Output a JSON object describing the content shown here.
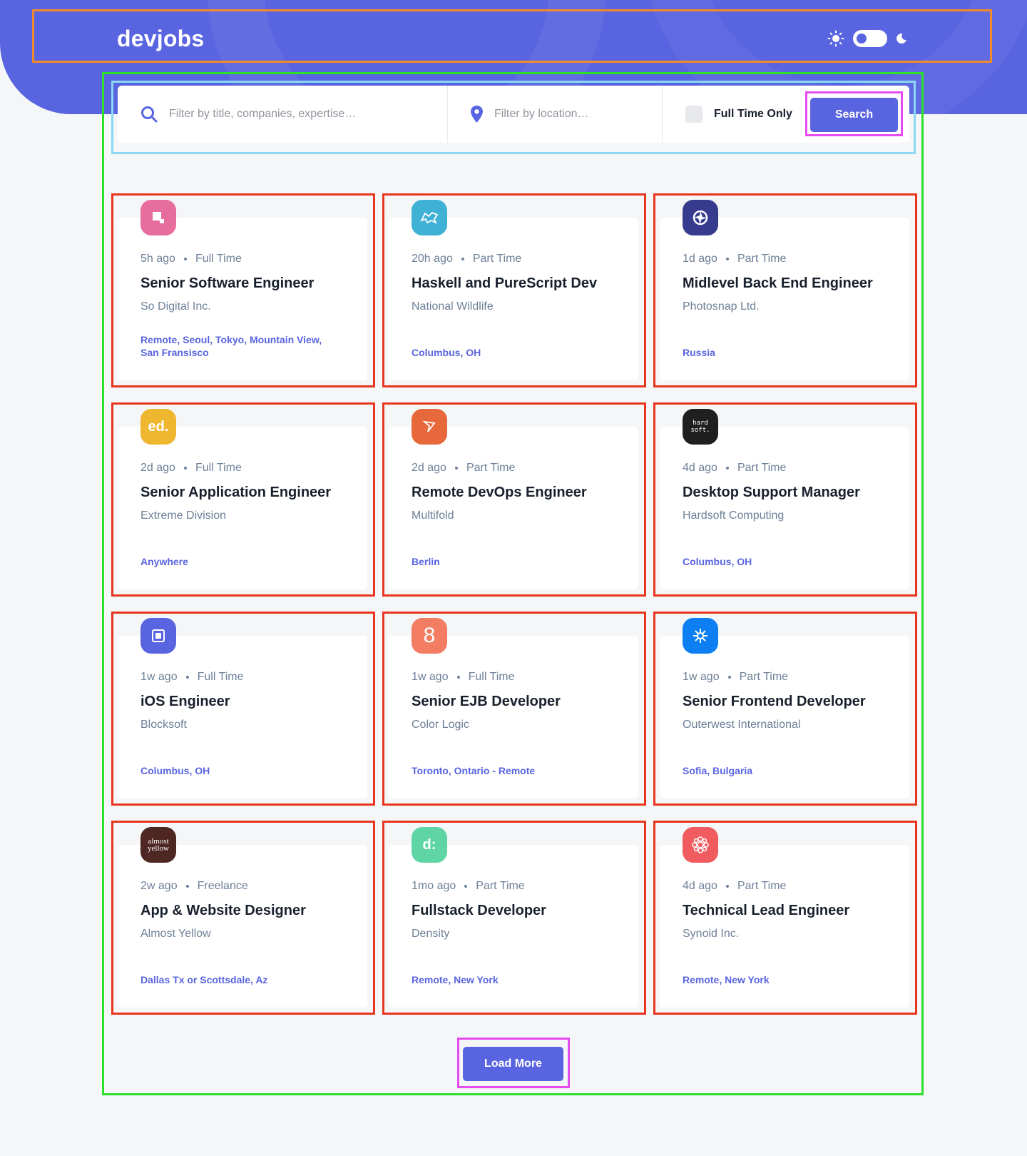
{
  "header": {
    "logo": "devjobs",
    "theme_toggle": {
      "state": "light",
      "icons": [
        "sun-icon",
        "moon-icon"
      ]
    }
  },
  "search": {
    "title_placeholder": "Filter by title, companies, expertise…",
    "location_placeholder": "Filter by location…",
    "fulltime_label": "Full Time Only",
    "button_label": "Search"
  },
  "jobs": [
    {
      "posted": "5h ago",
      "contract": "Full Time",
      "position": "Senior Software Engineer",
      "company": "So Digital Inc.",
      "location": "Remote, Seoul, Tokyo, Mountain View, San Fransisco",
      "logo_color": "#e66d9c",
      "logo_text": ""
    },
    {
      "posted": "20h ago",
      "contract": "Part Time",
      "position": "Haskell and PureScript Dev",
      "company": "National Wildlife",
      "location": "Columbus, OH",
      "logo_color": "#3fb1d4",
      "logo_text": ""
    },
    {
      "posted": "1d ago",
      "contract": "Part Time",
      "position": "Midlevel Back End Engineer",
      "company": "Photosnap Ltd.",
      "location": "Russia",
      "logo_color": "#363b8e",
      "logo_text": ""
    },
    {
      "posted": "2d ago",
      "contract": "Full Time",
      "position": "Senior Application Engineer",
      "company": "Extreme Division",
      "location": "Anywhere",
      "logo_color": "#efb630",
      "logo_text": "ed."
    },
    {
      "posted": "2d ago",
      "contract": "Part Time",
      "position": "Remote DevOps Engineer",
      "company": "Multifold",
      "location": "Berlin",
      "logo_color": "#e7683a",
      "logo_text": ""
    },
    {
      "posted": "4d ago",
      "contract": "Part Time",
      "position": "Desktop Support Manager",
      "company": "Hardsoft Computing",
      "location": "Columbus, OH",
      "logo_color": "#1f1f1f",
      "logo_text": "hard soft."
    },
    {
      "posted": "1w ago",
      "contract": "Full Time",
      "position": "iOS Engineer",
      "company": "Blocksoft",
      "location": "Columbus, OH",
      "logo_color": "#5964e0",
      "logo_text": ""
    },
    {
      "posted": "1w ago",
      "contract": "Full Time",
      "position": "Senior EJB Developer",
      "company": "Color Logic",
      "location": "Toronto, Ontario - Remote",
      "logo_color": "#f27d62",
      "logo_text": "8"
    },
    {
      "posted": "1w ago",
      "contract": "Part Time",
      "position": "Senior Frontend Developer",
      "company": "Outerwest International",
      "location": "Sofia, Bulgaria",
      "logo_color": "#0d7ff2",
      "logo_text": ""
    },
    {
      "posted": "2w ago",
      "contract": "Freelance",
      "position": "App & Website Designer",
      "company": "Almost Yellow",
      "location": "Dallas Tx or Scottsdale, Az",
      "logo_color": "#4e2723",
      "logo_text": "almost yellow"
    },
    {
      "posted": "1mo ago",
      "contract": "Part Time",
      "position": "Fullstack Developer",
      "company": "Density",
      "location": "Remote, New York",
      "logo_color": "#5fd5a6",
      "logo_text": "d:"
    },
    {
      "posted": "4d ago",
      "contract": "Part Time",
      "position": "Technical Lead Engineer",
      "company": "Synoid Inc.",
      "location": "Remote, New York",
      "logo_color": "#f05b60",
      "logo_text": ""
    }
  ],
  "load_more_label": "Load More"
}
